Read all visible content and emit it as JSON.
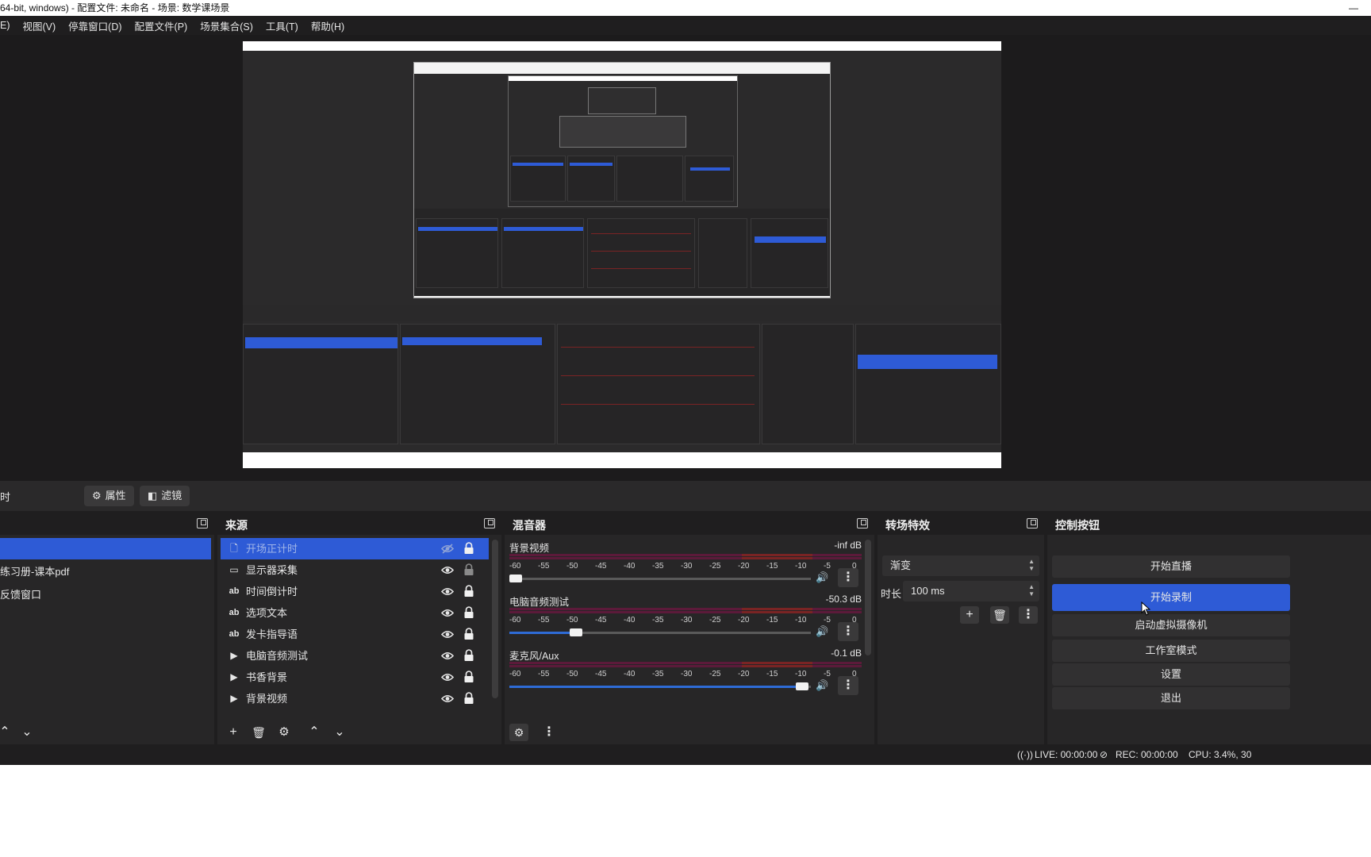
{
  "window": {
    "title": "64-bit, windows) - 配置文件: 未命名 - 场景: 数学课场景",
    "minimize": "—"
  },
  "menu": [
    "E)",
    "视图(V)",
    "停靠窗口(D)",
    "配置文件(P)",
    "场景集合(S)",
    "工具(T)",
    "帮助(H)"
  ],
  "scene_bar": {
    "label": "时",
    "properties": "属性",
    "filters": "滤镜"
  },
  "scenes": {
    "title": "",
    "items": [
      "",
      "练习册-课本pdf",
      "反馈窗口"
    ]
  },
  "sources": {
    "title": "来源",
    "items": [
      {
        "icon": "document-icon",
        "glyph": "🗋",
        "name": "开场正计时",
        "selected": true
      },
      {
        "icon": "display-capture-icon",
        "glyph": "▭",
        "name": "显示器采集",
        "selected": false
      },
      {
        "icon": "text-icon",
        "glyph": "ab",
        "name": "时间倒计时",
        "selected": false
      },
      {
        "icon": "text-icon",
        "glyph": "ab",
        "name": "选项文本",
        "selected": false
      },
      {
        "icon": "text-icon",
        "glyph": "ab",
        "name": "发卡指导语",
        "selected": false
      },
      {
        "icon": "media-play-icon",
        "glyph": "▶",
        "name": "电脑音频测试",
        "selected": false
      },
      {
        "icon": "media-play-icon",
        "glyph": "▶",
        "name": "书香背景",
        "selected": false
      },
      {
        "icon": "media-play-icon",
        "glyph": "▶",
        "name": "背景视频",
        "selected": false
      }
    ]
  },
  "mixer": {
    "title": "混音器",
    "tick_labels": [
      "-60",
      "-55",
      "-50",
      "-45",
      "-40",
      "-35",
      "-30",
      "-25",
      "-20",
      "-15",
      "-10",
      "-5",
      "0"
    ],
    "channels": [
      {
        "name": "背景视频",
        "db": "-inf dB",
        "volume": 0.02
      },
      {
        "name": "电脑音频测试",
        "db": "-50.3 dB",
        "volume": 0.22
      },
      {
        "name": "麦克风/Aux",
        "db": "-0.1 dB",
        "volume": 0.97
      }
    ]
  },
  "transitions": {
    "title": "转场特效",
    "type": "渐变",
    "duration_label": "时长",
    "duration": "100 ms"
  },
  "controls": {
    "title": "控制按钮",
    "buttons": [
      "开始直播",
      "开始录制",
      "启动虚拟摄像机",
      "工作室模式",
      "设置",
      "退出"
    ],
    "active_index": 1
  },
  "status": {
    "live": "LIVE: 00:00:00",
    "rec": "REC: 00:00:00",
    "cpu": "CPU: 3.4%, 30"
  },
  "colors": {
    "accent": "#2e5bd6",
    "background": "#1f1e1f",
    "panel": "#272627"
  }
}
